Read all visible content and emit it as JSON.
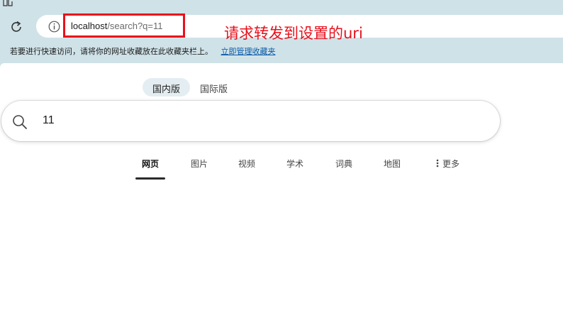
{
  "browser": {
    "address": {
      "url_host": "localhost",
      "url_path": "/search?q=11"
    },
    "annotation": "请求转发到设置的uri",
    "favorites_bar": {
      "message": "若要进行快速访问，请将你的网址收藏放在此收藏夹栏上。",
      "link": "立即管理收藏夹"
    },
    "colors": {
      "annotation_red": "#e8101c",
      "link_blue": "#0a5aa8",
      "chrome_bg": "#cfe2e8"
    }
  },
  "page": {
    "region_tabs": [
      {
        "label": "国内版",
        "active": true
      },
      {
        "label": "国际版",
        "active": false
      }
    ],
    "search": {
      "value": "11",
      "icon": "search-icon"
    },
    "nav_tabs": [
      {
        "label": "网页",
        "active": true
      },
      {
        "label": "图片"
      },
      {
        "label": "视频"
      },
      {
        "label": "学术"
      },
      {
        "label": "词典"
      },
      {
        "label": "地图"
      },
      {
        "label": "更多",
        "icon": "more-vertical-icon"
      }
    ]
  }
}
